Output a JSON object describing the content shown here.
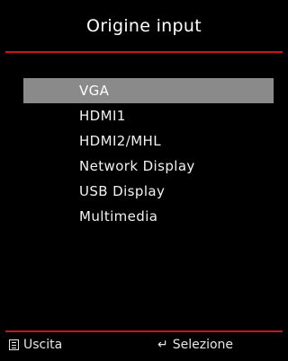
{
  "header": {
    "title": "Origine input"
  },
  "menu": {
    "items": [
      {
        "label": "VGA",
        "selected": true
      },
      {
        "label": "HDMI1",
        "selected": false
      },
      {
        "label": "HDMI2/MHL",
        "selected": false
      },
      {
        "label": "Network Display",
        "selected": false
      },
      {
        "label": "USB Display",
        "selected": false
      },
      {
        "label": "Multimedia",
        "selected": false
      }
    ]
  },
  "footer": {
    "exit_label": "Uscita",
    "exit_icon": "menu-icon",
    "select_label": "Selezione",
    "select_icon": "enter-icon"
  },
  "colors": {
    "background": "#000000",
    "accent_rule": "#c4161c",
    "selection": "#8a8a8a",
    "text": "#ffffff"
  }
}
